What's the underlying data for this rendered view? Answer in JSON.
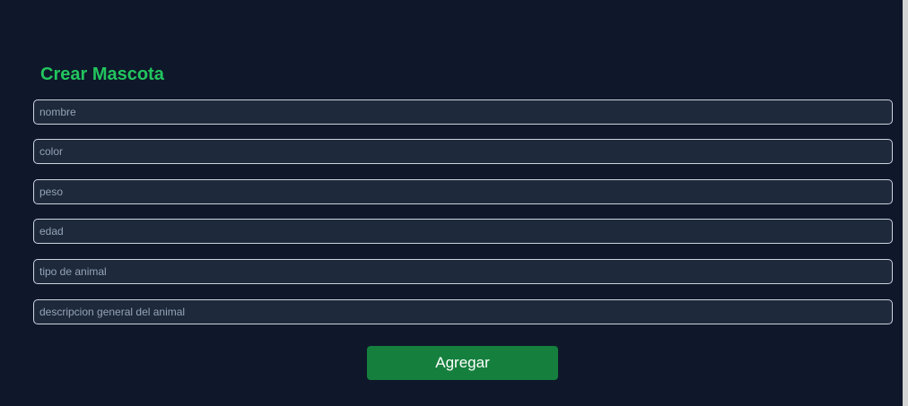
{
  "form": {
    "title": "Crear Mascota",
    "fields": [
      {
        "name": "nombre",
        "placeholder": "nombre",
        "value": ""
      },
      {
        "name": "color",
        "placeholder": "color",
        "value": ""
      },
      {
        "name": "peso",
        "placeholder": "peso",
        "value": ""
      },
      {
        "name": "edad",
        "placeholder": "edad",
        "value": ""
      },
      {
        "name": "tipo",
        "placeholder": "tipo de animal",
        "value": ""
      },
      {
        "name": "descripcion",
        "placeholder": "descripcion general del animal",
        "value": ""
      }
    ],
    "submit_label": "Agregar"
  },
  "colors": {
    "background": "#0f172a",
    "title": "#22c55e",
    "input_bg": "#1e293b",
    "button": "#15803d"
  }
}
